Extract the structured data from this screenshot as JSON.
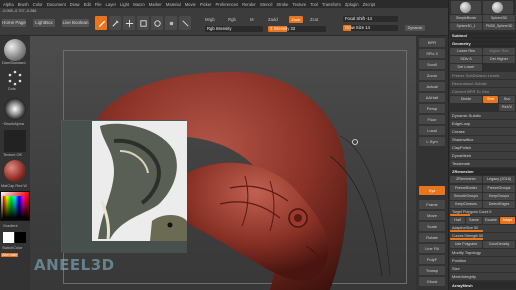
{
  "menubar": {
    "items": [
      "Alpha",
      "Brush",
      "Color",
      "Document",
      "Draw",
      "Edit",
      "File",
      "Layer",
      "Light",
      "Macro",
      "Marker",
      "Material",
      "Movie",
      "Picker",
      "Preferences",
      "Render",
      "Stencil",
      "Stroke",
      "Texture",
      "Tool",
      "Transform",
      "Zplugin",
      "Zscript"
    ]
  },
  "coords": "-0.065,-0.707,-0.286",
  "toolbar": {
    "home_page": "Home Page",
    "lightbox": "LightBox",
    "live_boolean": "Live Boolean",
    "edit": "Edit",
    "draw": "Draw",
    "move": "Move",
    "scale": "Scale",
    "rotate": "Rotate",
    "mrgb": "Mrgb",
    "rgb": "Rgb",
    "m": "M",
    "zadd": "Zadd",
    "zsub": "Zsub",
    "zcut": "Zcut",
    "rgb_intensity": "Rgb Intensity",
    "z_intensity": "Z Intensity 33",
    "z_intensity_value": 33,
    "focal_shift": "Focal Shift -14",
    "draw_size": "Draw Size 14",
    "draw_size_value": 14,
    "dynamic": "Dynamic"
  },
  "leftshelf": {
    "brush_label": "DamStandard",
    "stroke_label": "Dots",
    "alpha_label": "~BrushAlpha",
    "texture_label": "Texture Off",
    "material_label": "MatCap Red W",
    "gradient_label": "Gradient",
    "switch_label": "SwitchColor",
    "alternate_label": "Alternate"
  },
  "rightshelf": {
    "buttons": [
      "BPR",
      "SPix 3",
      "Scroll",
      "Zoom",
      "Actual",
      "AAHalf",
      "Persp",
      "Floor",
      "Local",
      "L.Sym",
      "Xyz",
      "Frame",
      "Move",
      "Scale",
      "Rotate",
      "Line Fill",
      "PolyF",
      "Transp",
      "Ghost",
      "Solo",
      "Xpose"
    ],
    "active": [
      "Xyz"
    ]
  },
  "rightpanel": {
    "tools": [
      "SimpleBrush",
      "Sphere3D"
    ],
    "subtool_list": [
      "Sphere3D_1",
      "PM3D_Sphere3D"
    ],
    "sections": {
      "subtool": "Subtool",
      "geometry": "Geometry",
      "lower_res": "Lower Res",
      "higher_res": "Higher Res",
      "sdiv": "SDiv 6",
      "del_lower": "Del Lower",
      "del_higher": "Del Higher",
      "freeze": "Freeze SubDivision Levels",
      "reconstruct": "Reconstruct Subdiv",
      "convert_bpr": "Convert BPR To Geo",
      "divide": "Divide",
      "smt": "Smt",
      "suv": "Suv",
      "reuv": "ReUV",
      "dynamic_subdiv": "Dynamic Subdiv",
      "edgeloop": "EdgeLoop",
      "crease": "Crease",
      "shadowbox": "ShadowBox",
      "clay_polish": "ClayPolish",
      "dynamesh": "DynaMesh",
      "tessimate": "Tessimate",
      "zremesher_hdr": "ZRemesher",
      "zremesher_btn": "ZRemesher",
      "legacy": "Legacy (2018)",
      "freeze_border": "FreezeBorder",
      "freeze_groups": "FreezeGroups",
      "smooth_groups": "SmoothGroups",
      "keep_groups": "KeepGroups",
      "keep_creases": "KeepCreases",
      "detect_edges": "DetectEdges",
      "target_polygons": "Target Polygons Count 5",
      "half": "Half",
      "same": "Same",
      "double": "Double",
      "adapt": "Adapt",
      "adaptive_size": "AdaptiveSize 50",
      "curves_strength": "Curves Strength 50",
      "use_polypaint": "Use Polypaint",
      "color_density": "ColorDensity",
      "modify_topology": "Modify Topology",
      "position": "Position",
      "size": "Size",
      "mesh_integrity": "MeshIntegrity",
      "array_mesh": "ArrayMesh"
    }
  },
  "watermark": "ANEEL3D"
}
